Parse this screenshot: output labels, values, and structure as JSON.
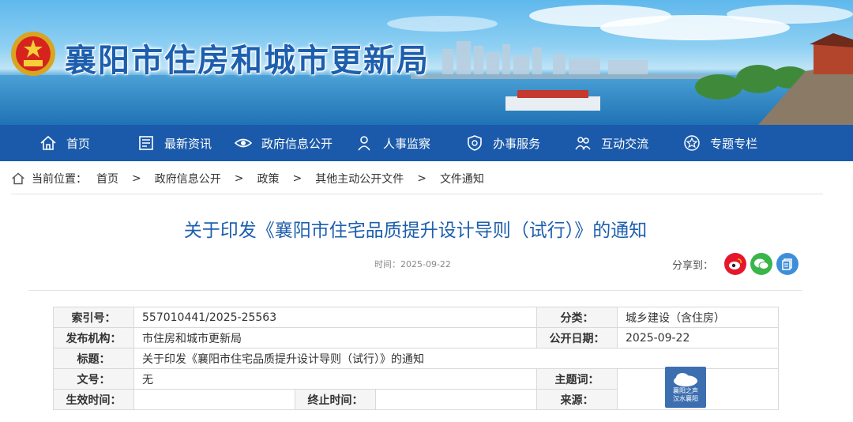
{
  "site": {
    "title": "襄阳市住房和城市更新局"
  },
  "nav": {
    "items": [
      {
        "label": "首页",
        "icon": "home-icon"
      },
      {
        "label": "最新资讯",
        "icon": "news-icon"
      },
      {
        "label": "政府信息公开",
        "icon": "eye-icon"
      },
      {
        "label": "人事监察",
        "icon": "person-icon"
      },
      {
        "label": "办事服务",
        "icon": "shield-icon"
      },
      {
        "label": "互动交流",
        "icon": "people-icon"
      },
      {
        "label": "专题专栏",
        "icon": "star-icon"
      }
    ]
  },
  "breadcrumb": {
    "prefix": "当前位置：",
    "sep": ">",
    "items": [
      "首页",
      "政府信息公开",
      "政策",
      "其他主动公开文件",
      "文件通知"
    ]
  },
  "article": {
    "title": "关于印发《襄阳市住宅品质提升设计导则（试行）》的通知",
    "time": "时间：2025-09-22"
  },
  "share": {
    "label": "分享到：",
    "icons": [
      "weibo-icon",
      "wechat-icon",
      "copy-icon"
    ],
    "colors": [
      "#e6162d",
      "#3ab54a",
      "#3f8fd8"
    ]
  },
  "meta": {
    "index_label": "索引号：",
    "index": "557010441/2025-25563",
    "category_label": "分类：",
    "category": "城乡建设（含住房）",
    "publisher_label": "发布机构：",
    "publisher": "市住房和城市更新局",
    "date_label": "公开日期：",
    "date": "2025-09-22",
    "title_label": "标题：",
    "title": "关于印发《襄阳市住宅品质提升设计导则（试行）》的通知",
    "docno_label": "文号：",
    "docno": "无",
    "keywords_label": "主题词：",
    "keywords": "",
    "effective_label": "生效时间：",
    "effective": "",
    "end_label": "终止时间：",
    "end": "",
    "source_label": "来源：",
    "source": ""
  },
  "watermark": {
    "top": "襄阳之声",
    "bottom": "汉水襄阳"
  }
}
